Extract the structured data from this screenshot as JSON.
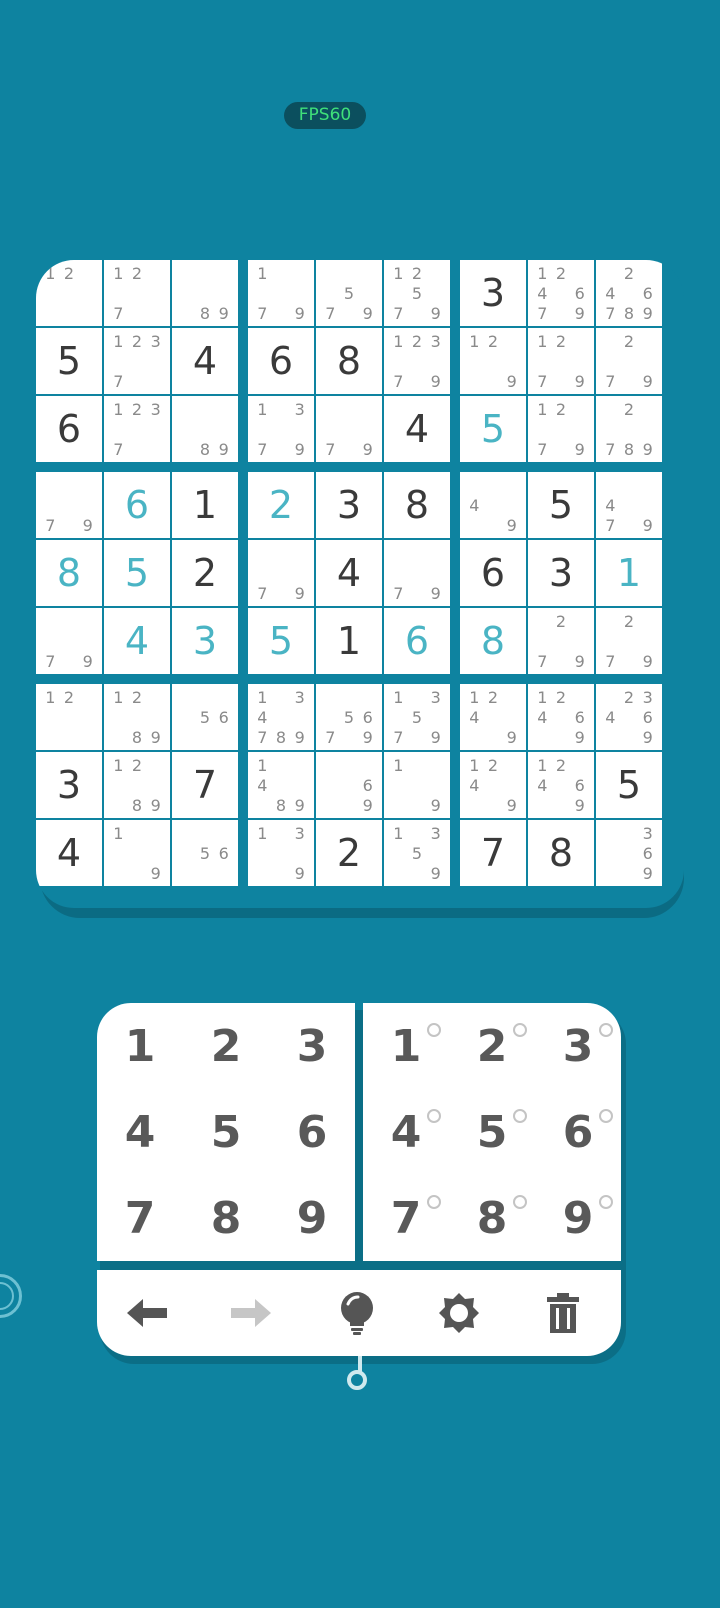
{
  "status": {
    "fps_label": "FPS60"
  },
  "colors": {
    "background": "#0e83a0",
    "given_digit": "#3a3a3a",
    "entered_digit": "#4ab4c4",
    "note_digit": "#8a8a8a"
  },
  "board": {
    "values": [
      [
        "",
        "",
        "",
        "",
        "",
        "",
        "3",
        "",
        ""
      ],
      [
        "5",
        "",
        "4",
        "6",
        "8",
        "",
        "",
        "",
        ""
      ],
      [
        "6",
        "",
        "",
        "",
        "",
        "4",
        "5",
        "",
        ""
      ],
      [
        "",
        "6",
        "1",
        "2",
        "3",
        "8",
        "",
        "5",
        ""
      ],
      [
        "8",
        "5",
        "2",
        "",
        "4",
        "",
        "6",
        "3",
        "1"
      ],
      [
        "",
        "4",
        "3",
        "5",
        "1",
        "6",
        "8",
        "",
        ""
      ],
      [
        "",
        "",
        "",
        "",
        "",
        "",
        "",
        "",
        ""
      ],
      [
        "3",
        "",
        "7",
        "",
        "",
        "",
        "",
        "",
        "5"
      ],
      [
        "4",
        "",
        "",
        "",
        "2",
        "",
        "7",
        "8",
        ""
      ]
    ],
    "entered": [
      [
        0,
        0,
        0,
        0,
        0,
        0,
        0,
        0,
        0
      ],
      [
        0,
        0,
        0,
        0,
        0,
        0,
        0,
        0,
        0
      ],
      [
        0,
        0,
        0,
        0,
        0,
        0,
        1,
        0,
        0
      ],
      [
        0,
        1,
        0,
        1,
        0,
        0,
        0,
        0,
        0
      ],
      [
        1,
        1,
        0,
        0,
        0,
        0,
        0,
        0,
        1
      ],
      [
        0,
        1,
        1,
        1,
        0,
        1,
        1,
        0,
        0
      ],
      [
        0,
        0,
        0,
        0,
        0,
        0,
        0,
        0,
        0
      ],
      [
        0,
        0,
        0,
        0,
        0,
        0,
        0,
        0,
        0
      ],
      [
        0,
        0,
        0,
        0,
        0,
        0,
        0,
        0,
        0
      ]
    ],
    "notes": [
      [
        "12",
        "127",
        "89",
        "179",
        "579",
        "12579",
        "",
        "124679",
        "246789"
      ],
      [
        "",
        "1237",
        "",
        "",
        "",
        "12379",
        "129",
        "1279",
        "279"
      ],
      [
        "",
        "1237",
        "89",
        "1379",
        "79",
        "",
        "",
        "1279",
        "2789"
      ],
      [
        "79",
        "",
        "",
        "",
        "",
        "",
        "49",
        "",
        "479"
      ],
      [
        "",
        "",
        "",
        "79",
        "",
        "79",
        "",
        "",
        ""
      ],
      [
        "79",
        "",
        "",
        "",
        "",
        "",
        "",
        "279",
        "279"
      ],
      [
        "12",
        "1289",
        "56",
        "134789",
        "5679",
        "13579",
        "1249",
        "12469",
        "234669"
      ],
      [
        "",
        "1289",
        "",
        "1489",
        "69",
        "19",
        "1249",
        "12469",
        ""
      ],
      [
        "",
        "19",
        "56",
        "139",
        "",
        "1359",
        "",
        "",
        "369"
      ]
    ]
  },
  "keypad": {
    "digits": [
      "1",
      "2",
      "3",
      "4",
      "5",
      "6",
      "7",
      "8",
      "9"
    ],
    "note_digits": [
      "1",
      "2",
      "3",
      "4",
      "5",
      "6",
      "7",
      "8",
      "9"
    ]
  },
  "toolbar": {
    "undo_icon": "arrow-left-icon",
    "redo_icon": "arrow-right-icon",
    "hint_icon": "lightbulb-icon",
    "settings_icon": "gear-icon",
    "clear_icon": "trash-icon"
  }
}
